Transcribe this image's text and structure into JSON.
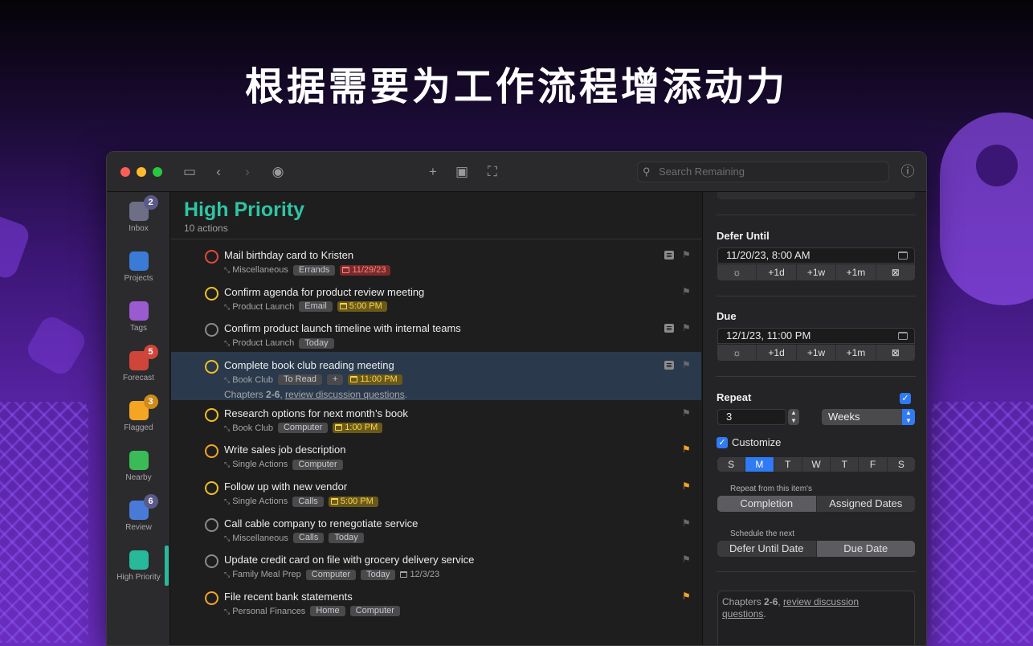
{
  "headline": "根据需要为工作流程增添动力",
  "toolbar": {
    "search_placeholder": "Search Remaining"
  },
  "sidebar": {
    "items": [
      {
        "label": "Inbox",
        "badge": "2",
        "icon": "inbox-icon",
        "color": "#6e6e86"
      },
      {
        "label": "Projects",
        "badge": "",
        "icon": "projects-icon",
        "color": "#3a7bd5"
      },
      {
        "label": "Tags",
        "badge": "",
        "icon": "tag-icon",
        "color": "#9a5ad0"
      },
      {
        "label": "Forecast",
        "badge": "5",
        "icon": "forecast-icon",
        "color": "#d0453a"
      },
      {
        "label": "Flagged",
        "badge": "3",
        "icon": "flag-icon",
        "color": "#f4a623"
      },
      {
        "label": "Nearby",
        "badge": "",
        "icon": "location-icon",
        "color": "#3bbb55"
      },
      {
        "label": "Review",
        "badge": "6",
        "icon": "review-icon",
        "color": "#4a7ad8"
      },
      {
        "label": "High Priority",
        "badge": "",
        "icon": "perspective-icon",
        "color": "#28b89a"
      }
    ]
  },
  "main": {
    "title": "High Priority",
    "count": "10 actions",
    "rows": [
      {
        "title": "Mail birthday card to Kristen",
        "project": "Miscellaneous",
        "tags": [
          "Errands"
        ],
        "due": "11/29/23",
        "due_style": "red",
        "circle": "#e04a3a",
        "note": true,
        "flagged": false
      },
      {
        "title": "Confirm agenda for product review meeting",
        "project": "Product Launch",
        "tags": [
          "Email"
        ],
        "due": "5:00 PM",
        "due_style": "yellow",
        "circle": "#f0c020",
        "note": false,
        "flagged": false
      },
      {
        "title": "Confirm product launch timeline with internal teams",
        "project": "Product Launch",
        "tags": [
          "Today"
        ],
        "due": "",
        "due_style": "",
        "circle": "#8a8a8e",
        "note": true,
        "flagged": false
      },
      {
        "title": "Complete book club reading meeting",
        "project": "Book Club",
        "tags": [
          "To Read",
          "+"
        ],
        "due": "11:00 PM",
        "due_style": "yellow",
        "circle": "#f0c020",
        "note": true,
        "flagged": false
      },
      {
        "title": "Research options for next month’s book",
        "project": "Book Club",
        "tags": [
          "Computer"
        ],
        "due": "1:00 PM",
        "due_style": "yellow",
        "circle": "#f0c020",
        "note": false,
        "flagged": false
      },
      {
        "title": "Write sales job description",
        "project": "Single Actions",
        "tags": [
          "Computer"
        ],
        "due": "",
        "due_style": "",
        "circle": "#f4a623",
        "note": false,
        "flagged": true
      },
      {
        "title": "Follow up with new vendor",
        "project": "Single Actions",
        "tags": [
          "Calls"
        ],
        "due": "5:00 PM",
        "due_style": "yellow",
        "circle": "#f0c020",
        "note": false,
        "flagged": true
      },
      {
        "title": "Call cable company to renegotiate service",
        "project": "Miscellaneous",
        "tags": [
          "Calls",
          "Today"
        ],
        "due": "",
        "due_style": "",
        "circle": "#8a8a8e",
        "note": false,
        "flagged": false
      },
      {
        "title": "Update credit card on file with grocery delivery service",
        "project": "Family Meal Prep",
        "tags": [
          "Computer",
          "Today"
        ],
        "due": "12/3/23",
        "due_style": "plain",
        "circle": "#8a8a8e",
        "note": false,
        "flagged": false
      },
      {
        "title": "File recent bank statements",
        "project": "Personal Finances",
        "tags": [
          "Home",
          "Computer"
        ],
        "due": "",
        "due_style": "",
        "circle": "#f4a623",
        "note": false,
        "flagged": true
      }
    ],
    "selected_note_prefix": "Chapters ",
    "selected_note_bold": "2-6",
    "selected_note_sep": ", ",
    "selected_note_link": "review discussion questions",
    "selected_note_end": "."
  },
  "inspector": {
    "defer_label": "Defer Until",
    "defer_value": "11/20/23, 8:00 AM",
    "due_label": "Due",
    "due_value": "12/1/23, 11:00 PM",
    "quick": [
      "+1d",
      "+1w",
      "+1m"
    ],
    "repeat_label": "Repeat",
    "repeat_count": "3",
    "repeat_unit": "Weeks",
    "customize_label": "Customize",
    "days": [
      "S",
      "M",
      "T",
      "W",
      "T",
      "F",
      "S"
    ],
    "selected_day_index": 1,
    "repeat_from_label": "Repeat from this item's",
    "repeat_from": [
      "Completion",
      "Assigned Dates"
    ],
    "schedule_label": "Schedule the next",
    "schedule": [
      "Defer Until Date",
      "Due Date"
    ],
    "note_prefix": "Chapters ",
    "note_bold": "2-6",
    "note_sep": ", ",
    "note_link1": "review discussion",
    "note_link2": "questions",
    "note_end": "."
  }
}
